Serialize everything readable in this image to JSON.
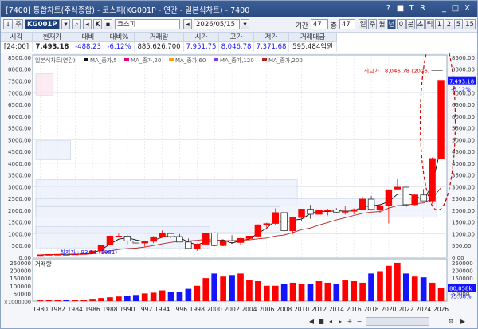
{
  "window": {
    "title": "[7400] 통합차트(주식종합) - 코스피(KG001P - 연간 - 일본식차트) - 7400",
    "controls": [
      "?",
      "■",
      "T",
      "R",
      "_",
      "□",
      "X"
    ]
  },
  "toolbar": {
    "code": "KG001P",
    "name": "코스피",
    "date": "2026/05/15",
    "period_label": "기간",
    "period_value": "47",
    "count_label": "종",
    "count_value": "47",
    "period_buttons": [
      "일",
      "주",
      "월",
      "년",
      "0",
      "분",
      "초",
      "틱",
      "1",
      "2",
      "5",
      "15"
    ],
    "selected_period": "년"
  },
  "quote": {
    "headers": [
      "시각",
      "현재가",
      "대비",
      "대비%",
      "거래량",
      "시가",
      "고가",
      "저가",
      "거래대금"
    ],
    "values": [
      "[24:00]",
      "7,493.18",
      "-488.23",
      "-6.12%",
      "885,626,700",
      "7,951.75",
      "8,046.78",
      "7,371.68",
      "595,484억원"
    ]
  },
  "legend": {
    "title": "일본식차트(연간)",
    "ma": [
      "MA_종가,5",
      "MA_종가,20",
      "MA_종가,60",
      "MA_종가,120",
      "MA_종가,200"
    ]
  },
  "annotations": {
    "high": "최고가 : 8,046.78 (2026)",
    "low": "최저가 : 93.14 (1981)"
  },
  "price_axis": {
    "ticks": [
      "8500.00",
      "8000.00",
      "7500.00",
      "7000.00",
      "6500.00",
      "6000.00",
      "5500.00",
      "5000.00",
      "4500.00",
      "4000.00",
      "3500.00",
      "3000.00",
      "2500.00",
      "2000.00",
      "1500.00",
      "1000.00",
      "500.00",
      "0.00"
    ],
    "last_price_label": "7,493.18",
    "last_change_label": "-6.12%"
  },
  "volume": {
    "label": "거래량",
    "ticks": [
      "250000",
      "200000",
      "150000",
      "100000",
      "50000"
    ],
    "unit": "×1000000",
    "last_label": "80,858k",
    "ratio_label": "75.68%"
  },
  "colors": {
    "up": "#ff0000",
    "down": "#1414ff",
    "ma_short": "#111111",
    "ma_long": "#b22222",
    "grid": "#d6dbe4"
  },
  "chart_data": {
    "type": "candlestick",
    "title": "",
    "x": [
      "1980",
      "1981",
      "1982",
      "1983",
      "1984",
      "1985",
      "1986",
      "1987",
      "1988",
      "1989",
      "1990",
      "1991",
      "1992",
      "1993",
      "1994",
      "1995",
      "1996",
      "1997",
      "1998",
      "1999",
      "2000",
      "2001",
      "2002",
      "2003",
      "2004",
      "2005",
      "2006",
      "2007",
      "2008",
      "2009",
      "2010",
      "2011",
      "2012",
      "2013",
      "2014",
      "2015",
      "2016",
      "2017",
      "2018",
      "2019",
      "2020",
      "2021",
      "2022",
      "2023",
      "2024",
      "2025",
      "2026"
    ],
    "x_tick_labels": [
      "1980",
      "1982",
      "1984",
      "1986",
      "1988",
      "1990",
      "1992",
      "1994",
      "1996",
      "1998",
      "2000",
      "2002",
      "2004",
      "2006",
      "2008",
      "2010",
      "2012",
      "2014",
      "2016",
      "2018",
      "2020",
      "2022",
      "2024",
      "2026"
    ],
    "ylim": [
      0,
      8600
    ],
    "open": [
      100,
      106,
      123,
      128,
      122,
      140,
      160,
      270,
      520,
      900,
      900,
      700,
      610,
      680,
      870,
      1010,
      880,
      650,
      380,
      560,
      1030,
      500,
      690,
      630,
      800,
      900,
      1400,
      1440,
      1900,
      1130,
      1690,
      2050,
      1830,
      2000,
      2010,
      1920,
      1960,
      2030,
      2470,
      2040,
      2180,
      2900,
      2980,
      2240,
      2650,
      2400,
      4200
    ],
    "high": [
      110,
      130,
      135,
      130,
      145,
      165,
      280,
      540,
      920,
      1010,
      940,
      750,
      700,
      900,
      1140,
      1020,
      990,
      800,
      590,
      1030,
      1060,
      720,
      940,
      830,
      900,
      1400,
      1470,
      2080,
      1900,
      1730,
      2060,
      2230,
      2060,
      2060,
      2090,
      2200,
      2080,
      2560,
      2610,
      2260,
      2880,
      3320,
      3000,
      2670,
      2900,
      4250,
      8046.78
    ],
    "low": [
      95,
      93.14,
      105,
      115,
      118,
      130,
      155,
      260,
      500,
      840,
      560,
      590,
      460,
      600,
      850,
      830,
      650,
      350,
      280,
      500,
      470,
      470,
      570,
      510,
      720,
      870,
      1200,
      1360,
      890,
      990,
      1550,
      1640,
      1760,
      1780,
      1880,
      1820,
      1820,
      2020,
      1990,
      1880,
      1440,
      2850,
      2130,
      2180,
      2390,
      2280,
      4100
    ],
    "close": [
      106,
      123,
      128,
      122,
      140,
      160,
      270,
      520,
      900,
      900,
      700,
      610,
      680,
      870,
      1010,
      880,
      650,
      380,
      560,
      1030,
      500,
      690,
      630,
      800,
      900,
      1380,
      1430,
      1900,
      1130,
      1690,
      2050,
      1830,
      2000,
      2010,
      1920,
      1960,
      2030,
      2470,
      2040,
      2190,
      2870,
      2980,
      2240,
      2650,
      2400,
      4200,
      7493.18
    ],
    "volume": [
      5000,
      6000,
      7000,
      8000,
      9000,
      10000,
      15000,
      20000,
      25000,
      30000,
      35000,
      40000,
      50000,
      55000,
      70000,
      60000,
      60000,
      80000,
      100000,
      150000,
      180000,
      160000,
      170000,
      180000,
      140000,
      130000,
      100000,
      100000,
      110000,
      120000,
      110000,
      110000,
      130000,
      120000,
      110000,
      135000,
      130000,
      120000,
      180000,
      195000,
      230000,
      250000,
      180000,
      160000,
      155000,
      120000,
      85000
    ],
    "ylabel": "",
    "xlabel": ""
  }
}
